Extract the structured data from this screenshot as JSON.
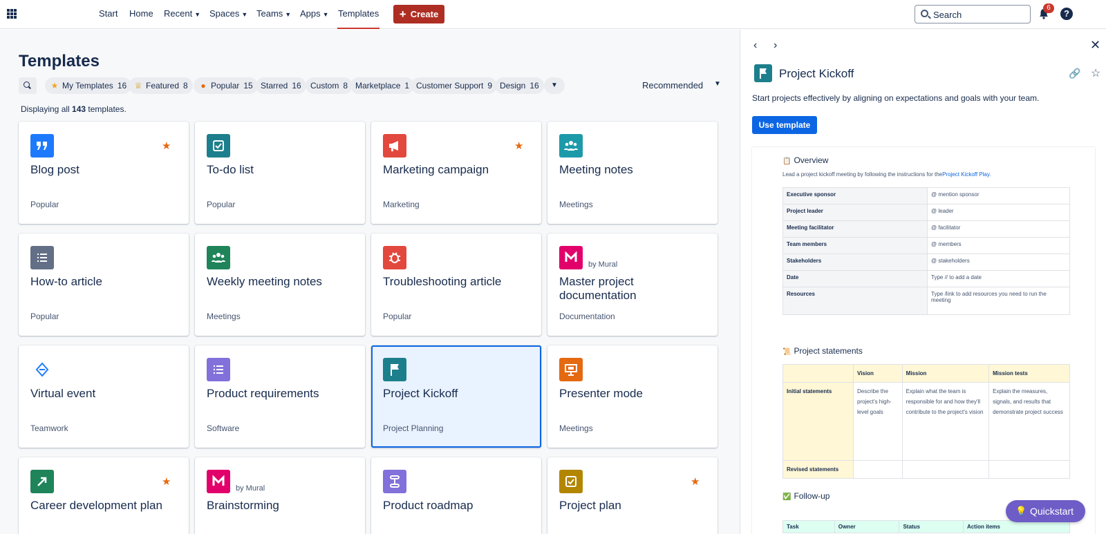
{
  "nav": {
    "items": [
      {
        "label": "Start",
        "dropdown": false
      },
      {
        "label": "Home",
        "dropdown": false
      },
      {
        "label": "Recent",
        "dropdown": true
      },
      {
        "label": "Spaces",
        "dropdown": true
      },
      {
        "label": "Teams",
        "dropdown": true
      },
      {
        "label": "Apps",
        "dropdown": true
      },
      {
        "label": "Templates",
        "dropdown": false,
        "active": true
      }
    ],
    "create_label": "Create",
    "search_placeholder": "Search",
    "notification_count": "6",
    "help_glyph": "?"
  },
  "main": {
    "title": "Templates",
    "filters": [
      {
        "label": "My Templates",
        "count": "16",
        "icon": "star-icon"
      },
      {
        "label": "Featured",
        "count": "8",
        "icon": "trophy-icon"
      },
      {
        "label": "Popular",
        "count": "15",
        "icon": "flame-icon"
      },
      {
        "label": "Starred",
        "count": "16"
      },
      {
        "label": "Custom",
        "count": "8"
      },
      {
        "label": "Marketplace",
        "count": "1"
      },
      {
        "label": "Customer Support",
        "count": "9"
      },
      {
        "label": "Design",
        "count": "16"
      }
    ],
    "sort_label": "Recommended",
    "count_prefix": "Displaying all",
    "count_value": "143",
    "count_suffix": "templates.",
    "cards": [
      {
        "title": "Blog post",
        "category": "Popular",
        "icon": "quote-icon",
        "color": "#1d7afc",
        "starred": true
      },
      {
        "title": "To-do list",
        "category": "Popular",
        "icon": "checkbox-icon",
        "color": "#1d7f8c",
        "starred": false
      },
      {
        "title": "Marketing campaign",
        "category": "Marketing",
        "icon": "megaphone-icon",
        "color": "#e2483d",
        "starred": true
      },
      {
        "title": "Meeting notes",
        "category": "Meetings",
        "icon": "people-icon",
        "color": "#1d9aaa",
        "starred": false
      },
      {
        "title": "How-to article",
        "category": "Popular",
        "icon": "numbered-list-icon",
        "color": "#626f86",
        "starred": false
      },
      {
        "title": "Weekly meeting notes",
        "category": "Meetings",
        "icon": "people-icon",
        "color": "#1f845a",
        "starred": false
      },
      {
        "title": "Troubleshooting article",
        "category": "Popular",
        "icon": "bug-icon",
        "color": "#e2483d",
        "starred": false
      },
      {
        "title": "Master project documentation",
        "category": "Documentation",
        "icon": "mural-icon",
        "color": "#e2006a",
        "starred": false,
        "by": "by Mural"
      },
      {
        "title": "Virtual event",
        "category": "Teamwork",
        "icon": "virtual-event-icon",
        "color": "#ffffff",
        "starred": false
      },
      {
        "title": "Product requirements",
        "category": "Software",
        "icon": "list-icon",
        "color": "#8270db",
        "starred": false
      },
      {
        "title": "Project Kickoff",
        "category": "Project Planning",
        "icon": "flag-icon",
        "color": "#1d7f8c",
        "starred": false,
        "selected": true
      },
      {
        "title": "Presenter mode",
        "category": "Meetings",
        "icon": "presentation-icon",
        "color": "#e56910",
        "starred": false
      },
      {
        "title": "Career development plan",
        "category": "",
        "icon": "arrow-up-right-icon",
        "color": "#1f845a",
        "starred": true
      },
      {
        "title": "Brainstorming",
        "category": "",
        "icon": "mural-icon",
        "color": "#e2006a",
        "starred": false,
        "by": "by Mural"
      },
      {
        "title": "Product roadmap",
        "category": "",
        "icon": "roadmap-icon",
        "color": "#8270db",
        "starred": false
      },
      {
        "title": "Project plan",
        "category": "",
        "icon": "checkbox-icon",
        "color": "#b38600",
        "starred": true
      }
    ]
  },
  "panel": {
    "title": "Project Kickoff",
    "description": "Start projects effectively by aligning on expectations and goals with your team.",
    "use_label": "Use template",
    "preview": {
      "overview_heading": "Overview",
      "overview_sub": "Lead a project kickoff meeting by following the instructions for the",
      "overview_link": "Project Kickoff Play",
      "overview_after": ".",
      "info_rows": [
        {
          "key": "Executive sponsor",
          "value": "@ mention sponsor"
        },
        {
          "key": "Project leader",
          "value": "@ leader"
        },
        {
          "key": "Meeting facilitator",
          "value": "@ facilitator"
        },
        {
          "key": "Team members",
          "value": "@ members"
        },
        {
          "key": "Stakeholders",
          "value": "@ stakeholders"
        },
        {
          "key": "Date",
          "value": "Type // to add a date"
        },
        {
          "key": "Resources",
          "value": "Type /link to add resources you need to run the meeting"
        }
      ],
      "statements_heading": "Project statements",
      "statements_cols": [
        "Vision",
        "Mission",
        "Mission tests"
      ],
      "statements_rows": [
        {
          "label": "Initial statements",
          "cells": [
            "Describe the project's high-level goals",
            "Explain what the team is responsible for and how they'll contribute to the project's vision",
            "Explain the measures, signals, and results that demonstrate project success"
          ]
        },
        {
          "label": "Revised statements",
          "cells": [
            "",
            "",
            ""
          ]
        }
      ],
      "followup_heading": "Follow-up",
      "followup_cols": [
        "Task",
        "Owner",
        "Status",
        "Action items"
      ]
    }
  },
  "quickstart_label": "Quickstart"
}
